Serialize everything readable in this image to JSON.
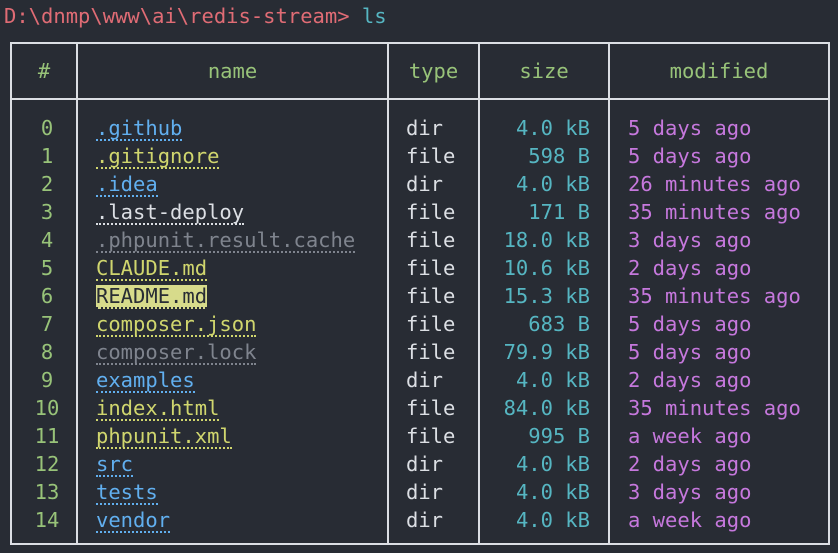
{
  "prompt": {
    "path": "D:\\dnmp\\www\\ai\\redis-stream>",
    "command": "ls"
  },
  "headers": {
    "index": "#",
    "name": "name",
    "type": "type",
    "size": "size",
    "modified": "modified"
  },
  "rows": [
    {
      "index": "0",
      "name": ".github",
      "type": "dir",
      "size": "4.0 kB",
      "modified": "5 days ago",
      "style": "dir"
    },
    {
      "index": "1",
      "name": ".gitignore",
      "type": "file",
      "size": "598 B",
      "modified": "5 days ago",
      "style": "file"
    },
    {
      "index": "2",
      "name": ".idea",
      "type": "dir",
      "size": "4.0 kB",
      "modified": "26 minutes ago",
      "style": "dir"
    },
    {
      "index": "3",
      "name": ".last-deploy",
      "type": "file",
      "size": "171 B",
      "modified": "35 minutes ago",
      "style": "hidden"
    },
    {
      "index": "4",
      "name": ".phpunit.result.cache",
      "type": "file",
      "size": "18.0 kB",
      "modified": "3 days ago",
      "style": "dim"
    },
    {
      "index": "5",
      "name": "CLAUDE.md",
      "type": "file",
      "size": "10.6 kB",
      "modified": "2 days ago",
      "style": "file"
    },
    {
      "index": "6",
      "name": "README.md",
      "type": "file",
      "size": "15.3 kB",
      "modified": "35 minutes ago",
      "style": "hl"
    },
    {
      "index": "7",
      "name": "composer.json",
      "type": "file",
      "size": "683 B",
      "modified": "5 days ago",
      "style": "file"
    },
    {
      "index": "8",
      "name": "composer.lock",
      "type": "file",
      "size": "79.9 kB",
      "modified": "5 days ago",
      "style": "dim"
    },
    {
      "index": "9",
      "name": "examples",
      "type": "dir",
      "size": "4.0 kB",
      "modified": "2 days ago",
      "style": "dir"
    },
    {
      "index": "10",
      "name": "index.html",
      "type": "file",
      "size": "84.0 kB",
      "modified": "35 minutes ago",
      "style": "file"
    },
    {
      "index": "11",
      "name": "phpunit.xml",
      "type": "file",
      "size": "995 B",
      "modified": "a week ago",
      "style": "file"
    },
    {
      "index": "12",
      "name": "src",
      "type": "dir",
      "size": "4.0 kB",
      "modified": "2 days ago",
      "style": "dir"
    },
    {
      "index": "13",
      "name": "tests",
      "type": "dir",
      "size": "4.0 kB",
      "modified": "3 days ago",
      "style": "dir"
    },
    {
      "index": "14",
      "name": "vendor",
      "type": "dir",
      "size": "4.0 kB",
      "modified": "a week ago",
      "style": "dir"
    }
  ],
  "colors": {
    "background": "#282c34",
    "border": "#dcdfe4",
    "path": "#e06c75",
    "command": "#56b6c2",
    "header": "#98c379",
    "dir": "#61afef",
    "file": "#d0d66e",
    "size": "#56b6c2",
    "modified": "#c678dd",
    "dim": "#7f848e"
  }
}
